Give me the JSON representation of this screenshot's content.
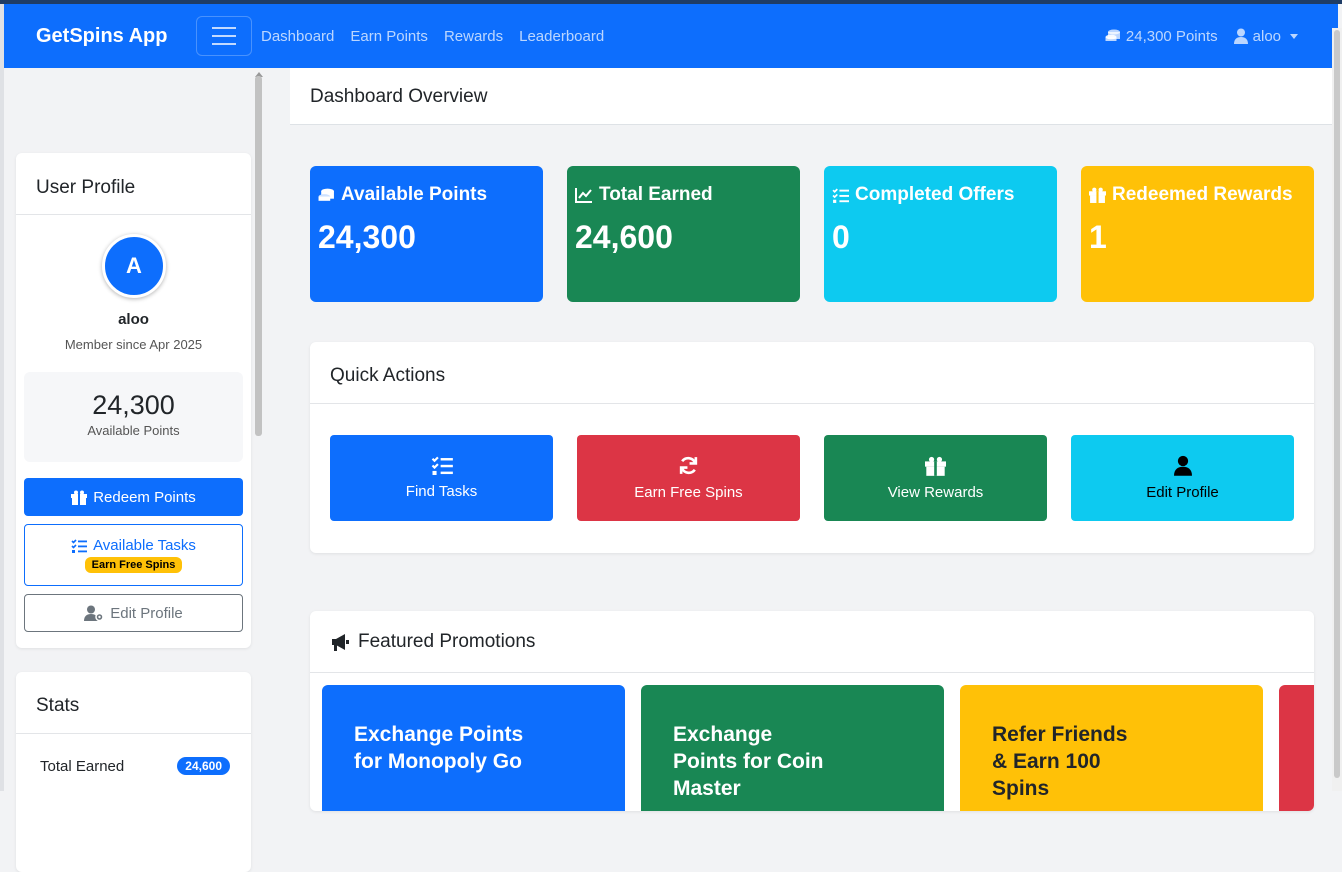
{
  "navbar": {
    "brand": "GetSpins App",
    "links": [
      "Dashboard",
      "Earn Points",
      "Rewards",
      "Leaderboard"
    ],
    "points": "24,300 Points",
    "user": "aloo"
  },
  "profile": {
    "title": "User Profile",
    "initial": "A",
    "name": "aloo",
    "member_since": "Member since Apr 2025",
    "points_value": "24,300",
    "points_label": "Available Points",
    "redeem_label": "Redeem Points",
    "tasks_label": "Available Tasks",
    "tasks_badge": "Earn Free Spins",
    "edit_label": "Edit Profile"
  },
  "stats": {
    "title": "Stats",
    "rows": [
      {
        "label": "Total Earned",
        "value": "24,600"
      }
    ]
  },
  "main": {
    "title": "Dashboard Overview"
  },
  "stat_cards": [
    {
      "label": "Available Points",
      "value": "24,300",
      "color": "#0d6efd",
      "icon": "coins-icon"
    },
    {
      "label": "Total Earned",
      "value": "24,600",
      "color": "#198754",
      "icon": "chart-line-icon"
    },
    {
      "label": "Completed Offers",
      "value": "0",
      "color": "#0dcaf0",
      "icon": "list-check-icon"
    },
    {
      "label": "Redeemed Rewards",
      "value": "1",
      "color": "#ffc107",
      "icon": "gift-icon"
    }
  ],
  "quick_actions": {
    "title": "Quick Actions",
    "buttons": [
      {
        "label": "Find Tasks",
        "color": "#0d6efd",
        "icon": "list-check-icon"
      },
      {
        "label": "Earn Free Spins",
        "color": "#dc3545",
        "icon": "sync-icon"
      },
      {
        "label": "View Rewards",
        "color": "#198754",
        "icon": "gift-icon"
      },
      {
        "label": "Edit Profile",
        "color": "#0dcaf0",
        "icon": "user-icon"
      }
    ]
  },
  "promotions": {
    "title": "Featured Promotions",
    "items": [
      {
        "label": "Exchange Points for Monopoly Go",
        "color": "#0d6efd"
      },
      {
        "label": "Exchange Points for Coin Master",
        "color": "#198754"
      },
      {
        "label": "Refer Friends & Earn 100 Spins",
        "color": "#ffc107"
      }
    ]
  }
}
